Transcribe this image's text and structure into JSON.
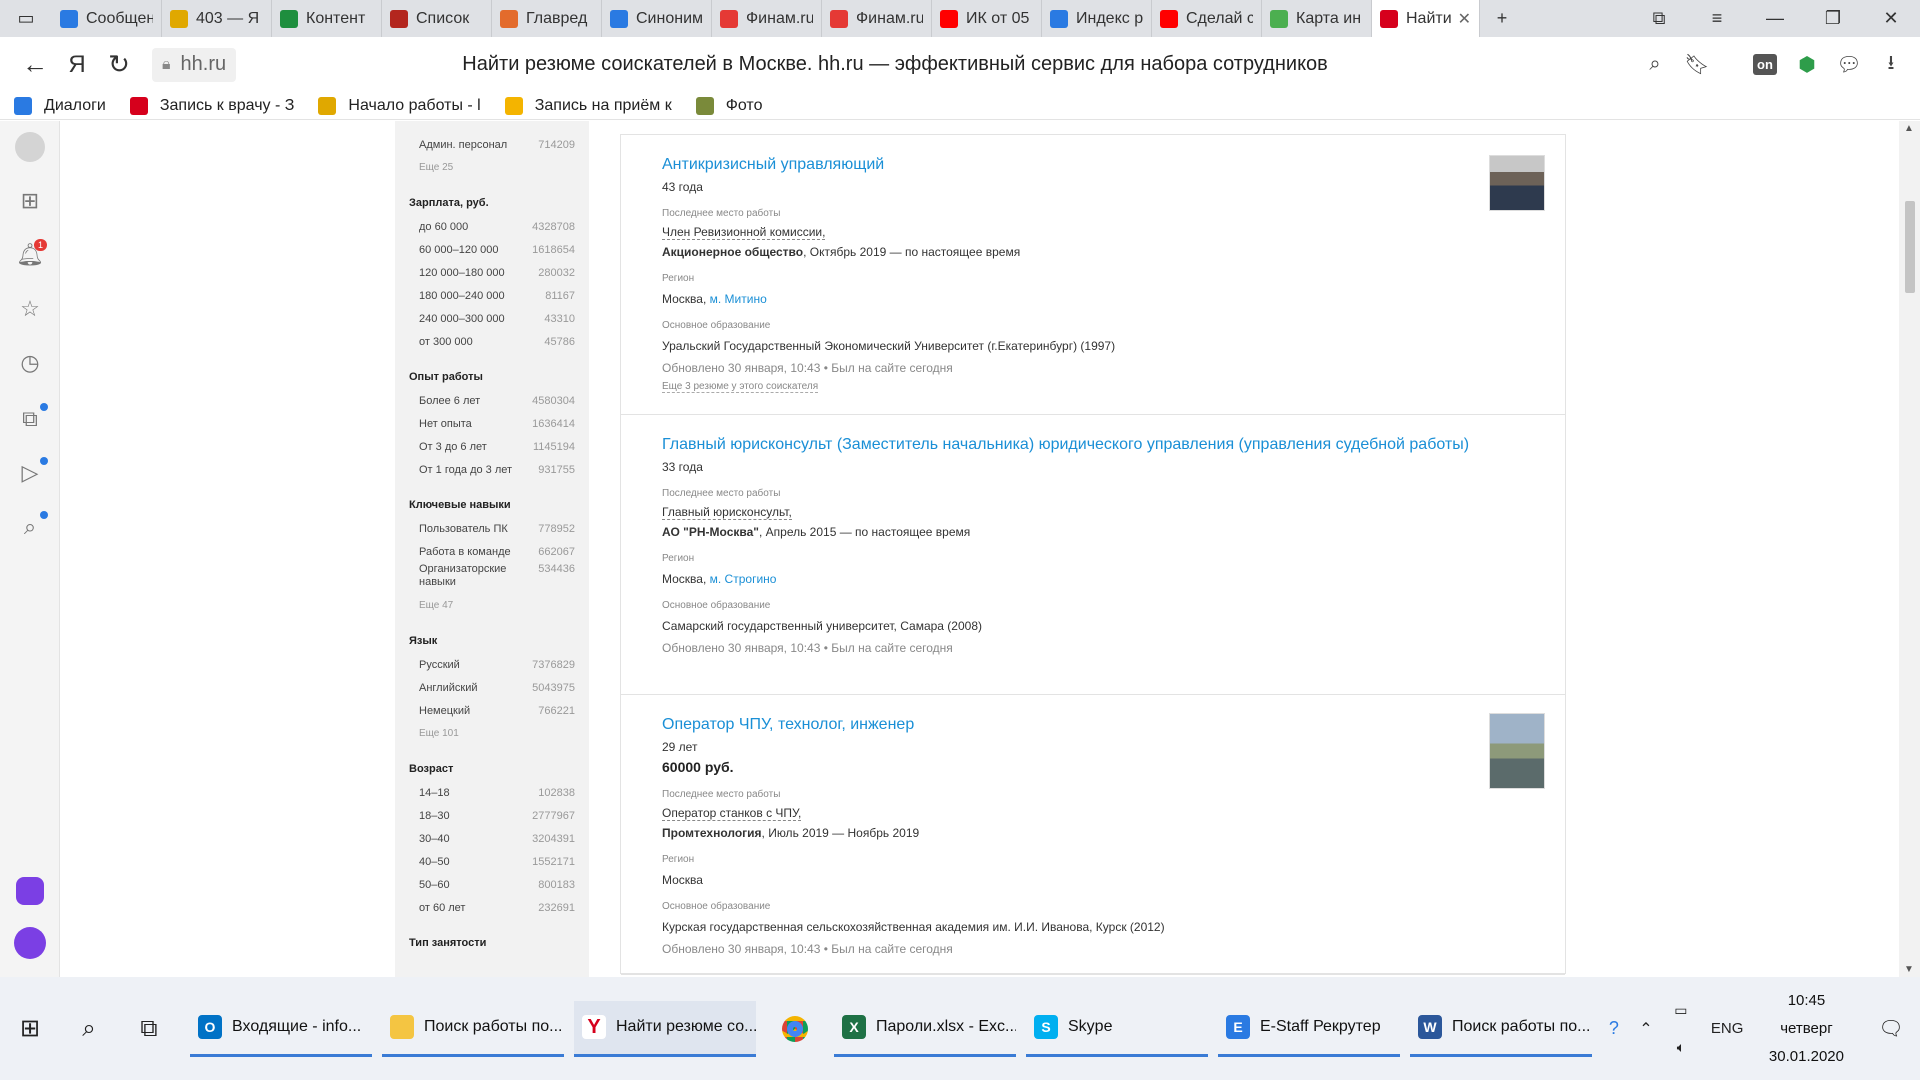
{
  "browser": {
    "tabs": [
      {
        "label": "Сообщения",
        "icon": "message-icon",
        "color": "#2a7ae2"
      },
      {
        "label": "403 — Я",
        "icon": "grid-icon",
        "color": "#e0a800"
      },
      {
        "label": "Контент",
        "icon": "plus-icon",
        "color": "#1e8e3e"
      },
      {
        "label": "Список",
        "icon": "arrows-icon",
        "color": "#b3261e"
      },
      {
        "label": "Главред",
        "icon": "glavred-icon",
        "color": "#e36b2c"
      },
      {
        "label": "Синоним",
        "icon": "s-icon",
        "color": "#2a7ae2"
      },
      {
        "label": "Финам.ru",
        "icon": "finam-icon",
        "color": "#e53935"
      },
      {
        "label": "Финам.ru",
        "icon": "finam-icon",
        "color": "#e53935"
      },
      {
        "label": "ИК от 05",
        "icon": "youtube-icon",
        "color": "#ff0000"
      },
      {
        "label": "Индекс р",
        "icon": "index-icon",
        "color": "#2a7ae2"
      },
      {
        "label": "Сделай с",
        "icon": "youtube-icon",
        "color": "#ff0000"
      },
      {
        "label": "Карта ин",
        "icon": "map-icon",
        "color": "#4caf50"
      },
      {
        "label": "Найти",
        "icon": "hh-icon",
        "color": "#d6001c",
        "active": true
      }
    ],
    "url": "hh.ru",
    "page_title": "Найти резюме соискателей в Москве. hh.ru — эффективный сервис для набора сотрудников",
    "bookmarks": [
      {
        "label": "Диалоги",
        "color": "#2a7ae2"
      },
      {
        "label": "Запись к врачу - З",
        "color": "#d6001c"
      },
      {
        "label": "Начало работы - l",
        "color": "#e0a800"
      },
      {
        "label": "Запись на приём к",
        "color": "#f4b400"
      },
      {
        "label": "Фото",
        "color": "#7a8a3a"
      }
    ],
    "notification_badge": "1"
  },
  "filters": {
    "top_row": {
      "label": "Админ. персонал",
      "count": "714209"
    },
    "top_more": "Еще 25",
    "groups": [
      {
        "title": "Зарплата, руб.",
        "items": [
          {
            "label": "до 60 000",
            "count": "4328708"
          },
          {
            "label": "60 000–120 000",
            "count": "1618654"
          },
          {
            "label": "120 000–180 000",
            "count": "280032"
          },
          {
            "label": "180 000–240 000",
            "count": "81167"
          },
          {
            "label": "240 000–300 000",
            "count": "43310"
          },
          {
            "label": "от 300 000",
            "count": "45786"
          }
        ],
        "more": ""
      },
      {
        "title": "Опыт работы",
        "items": [
          {
            "label": "Более 6 лет",
            "count": "4580304"
          },
          {
            "label": "Нет опыта",
            "count": "1636414"
          },
          {
            "label": "От 3 до 6 лет",
            "count": "1145194"
          },
          {
            "label": "От 1 года до 3 лет",
            "count": "931755"
          }
        ],
        "more": ""
      },
      {
        "title": "Ключевые навыки",
        "items": [
          {
            "label": "Пользователь ПК",
            "count": "778952"
          },
          {
            "label": "Работа в команде",
            "count": "662067"
          },
          {
            "label": "Организаторские навыки",
            "count": "534436"
          }
        ],
        "more": "Еще 47"
      },
      {
        "title": "Язык",
        "items": [
          {
            "label": "Русский",
            "count": "7376829"
          },
          {
            "label": "Английский",
            "count": "5043975"
          },
          {
            "label": "Немецкий",
            "count": "766221"
          }
        ],
        "more": "Еще 101"
      },
      {
        "title": "Возраст",
        "items": [
          {
            "label": "14–18",
            "count": "102838"
          },
          {
            "label": "18–30",
            "count": "2777967"
          },
          {
            "label": "30–40",
            "count": "3204391"
          },
          {
            "label": "40–50",
            "count": "1552171"
          },
          {
            "label": "50–60",
            "count": "800183"
          },
          {
            "label": "от 60 лет",
            "count": "232691"
          }
        ],
        "more": ""
      },
      {
        "title": "Тип занятости",
        "items": [],
        "more": ""
      }
    ]
  },
  "resumes": [
    {
      "title": "Антикризисный управляющий",
      "age": "43 года",
      "salary": "",
      "last_work_label": "Последнее место работы",
      "position": "Член Ревизионной комиссии,",
      "company": "Акционерное общество",
      "period": ", Октябрь 2019 — по настоящее время",
      "region_label": "Регион",
      "city": "Москва, ",
      "metro": "м. Митино",
      "edu_label": "Основное образование",
      "education": "Уральский Государственный Экономический Университет (г.Екатеринбург) (1997)",
      "updated": "Обновлено 30 января, 10:43  •  Был на сайте сегодня",
      "more": "Еще 3 резюме у этого соискателя",
      "has_photo": true
    },
    {
      "title": "Главный юрисконсульт (Заместитель начальника) юридического управления (управления судебной работы)",
      "age": "33 года",
      "salary": "",
      "last_work_label": "Последнее место работы",
      "position": "Главный юрисконсульт,",
      "company": "АО \"РН-Москва\"",
      "period": ", Апрель 2015 — по настоящее время",
      "region_label": "Регион",
      "city": "Москва, ",
      "metro": "м. Строгино",
      "edu_label": "Основное образование",
      "education": "Самарский государственный университет, Самара (2008)",
      "updated": "Обновлено 30 января, 10:43  •  Был на сайте сегодня",
      "more": "",
      "has_photo": false
    },
    {
      "title": "Оператор ЧПУ, технолог, инженер",
      "age": "29 лет",
      "salary": "60000 руб.",
      "last_work_label": "Последнее место работы",
      "position": "Оператор станков с ЧПУ,",
      "company": "Промтехнология",
      "period": ", Июль 2019 — Ноябрь 2019",
      "region_label": "Регион",
      "city": "Москва",
      "metro": "",
      "edu_label": "Основное образование",
      "education": "Курская государственная сельскохозяйственная академия им. И.И. Иванова, Курск (2012)",
      "updated": "Обновлено 30 января, 10:43  •  Был на сайте сегодня",
      "more": "",
      "has_photo": true
    }
  ],
  "taskbar": {
    "tasks": [
      {
        "label": "Входящие - info...",
        "color": "#0072c6",
        "letter": "O"
      },
      {
        "label": "Поиск работы по...",
        "color": "#f4c542",
        "letter": ""
      },
      {
        "label": "Найти резюме со...",
        "color": "#ffffff",
        "letter": "Y",
        "active": true
      },
      {
        "label": "",
        "color": "#ffffff",
        "letter": "",
        "icon": "chrome-icon"
      },
      {
        "label": "Пароли.xlsx - Exc...",
        "color": "#1e7145",
        "letter": "X"
      },
      {
        "label": "Skype",
        "color": "#00aff0",
        "letter": "S"
      },
      {
        "label": "E-Staff Рекрутер",
        "color": "#2a7ae2",
        "letter": "E"
      },
      {
        "label": "Поиск работы по...",
        "color": "#2b579a",
        "letter": "W"
      }
    ],
    "lang": "ENG",
    "time": "10:45",
    "day": "четверг",
    "date": "30.01.2020"
  }
}
